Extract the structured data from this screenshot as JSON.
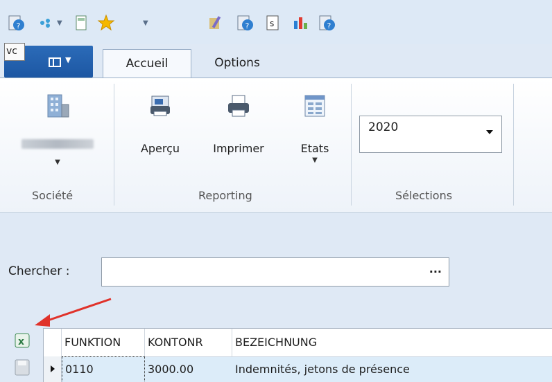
{
  "app": {
    "tooltip": "vc",
    "tabs": [
      {
        "label": "Accueil"
      },
      {
        "label": "Options"
      }
    ]
  },
  "ribbon": {
    "societe": {
      "button_label": "",
      "group_label": "Société"
    },
    "reporting": {
      "group_label": "Reporting",
      "apercu": "Aperçu",
      "imprimer": "Imprimer",
      "etats": "Etats"
    },
    "selections": {
      "group_label": "Sélections",
      "year_value": "2020"
    }
  },
  "search": {
    "label": "Chercher :",
    "value": "",
    "more": "..."
  },
  "grid": {
    "columns": [
      "FUNKTION",
      "KONTONR",
      "BEZEICHNUNG"
    ],
    "rows": [
      [
        "0110",
        "3000.00",
        "Indemnités, jetons de présence"
      ]
    ]
  },
  "colors": {
    "app_button": "#1d57a3",
    "arrow": "#e0322a",
    "selected_row": "#dcecf9"
  }
}
